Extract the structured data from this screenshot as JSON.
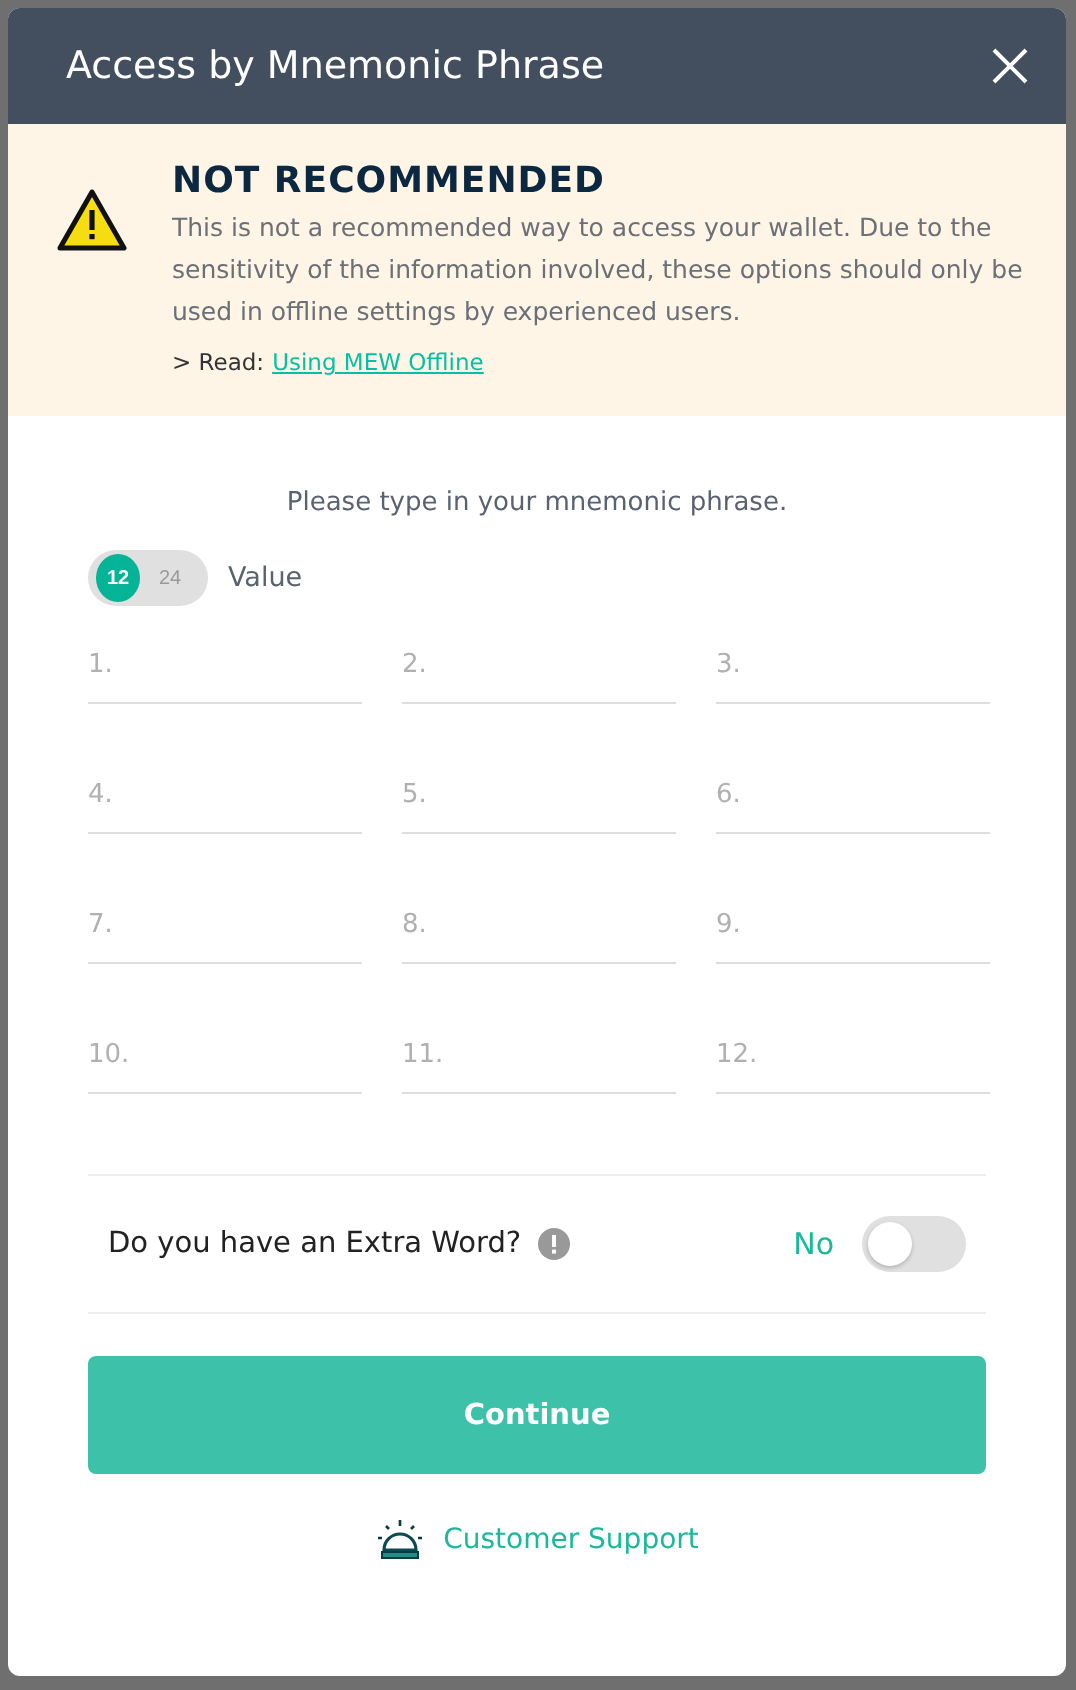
{
  "dialog": {
    "title": "Access by Mnemonic Phrase"
  },
  "warning": {
    "title": "NOT RECOMMENDED",
    "text": "This is not a recommended way to access your wallet. Due to the sensitivity of the information involved, these options should only be used in offline settings by experienced users.",
    "read_prefix": "> Read:",
    "read_link": "Using MEW Offline"
  },
  "instruction": "Please type in your mnemonic phrase.",
  "word_count": {
    "options": [
      {
        "label": "12",
        "selected": true
      },
      {
        "label": "24",
        "selected": false
      }
    ],
    "label": "Value"
  },
  "words": [
    {
      "placeholder": "1."
    },
    {
      "placeholder": "2."
    },
    {
      "placeholder": "3."
    },
    {
      "placeholder": "4."
    },
    {
      "placeholder": "5."
    },
    {
      "placeholder": "6."
    },
    {
      "placeholder": "7."
    },
    {
      "placeholder": "8."
    },
    {
      "placeholder": "9."
    },
    {
      "placeholder": "10."
    },
    {
      "placeholder": "11."
    },
    {
      "placeholder": "12."
    }
  ],
  "extra_word": {
    "label": "Do you have an Extra Word?",
    "status": "No",
    "on": false
  },
  "continue_button": "Continue",
  "support_link": "Customer Support"
}
